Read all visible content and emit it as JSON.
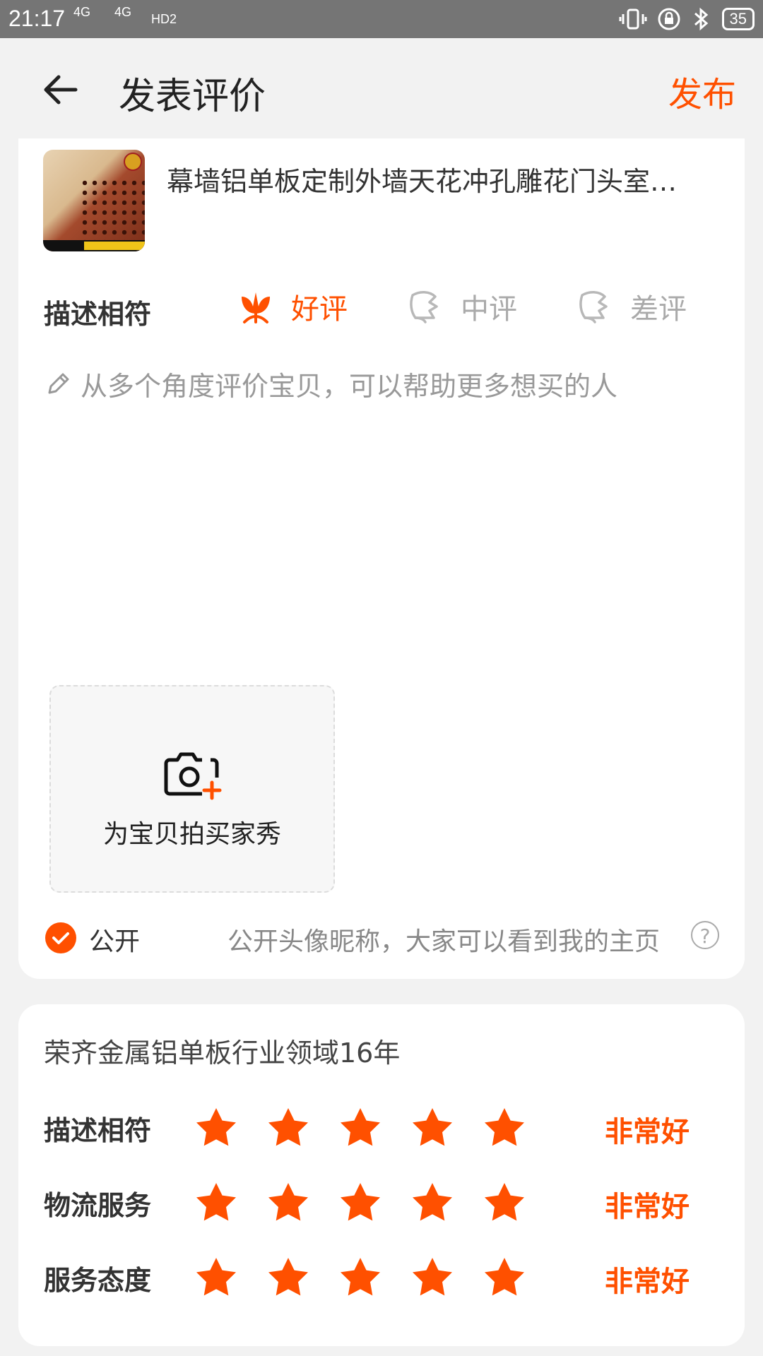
{
  "status_bar": {
    "time": "21:17",
    "signal1": "4G",
    "signal2": "4G",
    "hd": "HD2",
    "battery": "35"
  },
  "header": {
    "title": "发表评价",
    "publish": "发布"
  },
  "product": {
    "title": "幕墙铝单板定制外墙天花冲孔雕花门头室…"
  },
  "rating": {
    "label": "描述相符",
    "options": [
      {
        "label": "好评",
        "selected": true
      },
      {
        "label": "中评",
        "selected": false
      },
      {
        "label": "差评",
        "selected": false
      }
    ]
  },
  "review": {
    "placeholder": "从多个角度评价宝贝，可以帮助更多想买的人"
  },
  "photo": {
    "label": "为宝贝拍买家秀"
  },
  "public": {
    "label": "公开",
    "description": "公开头像昵称，大家可以看到我的主页",
    "checked": true
  },
  "shop": {
    "name": "荣齐金属铝单板行业领域16年",
    "scores": [
      {
        "label": "描述相符",
        "stars": 5,
        "text": "非常好"
      },
      {
        "label": "物流服务",
        "stars": 5,
        "text": "非常好"
      },
      {
        "label": "服务态度",
        "stars": 5,
        "text": "非常好"
      }
    ]
  },
  "colors": {
    "accent": "#ff5000",
    "text_primary": "#333333",
    "text_placeholder": "#999999",
    "background": "#f2f2f2"
  }
}
